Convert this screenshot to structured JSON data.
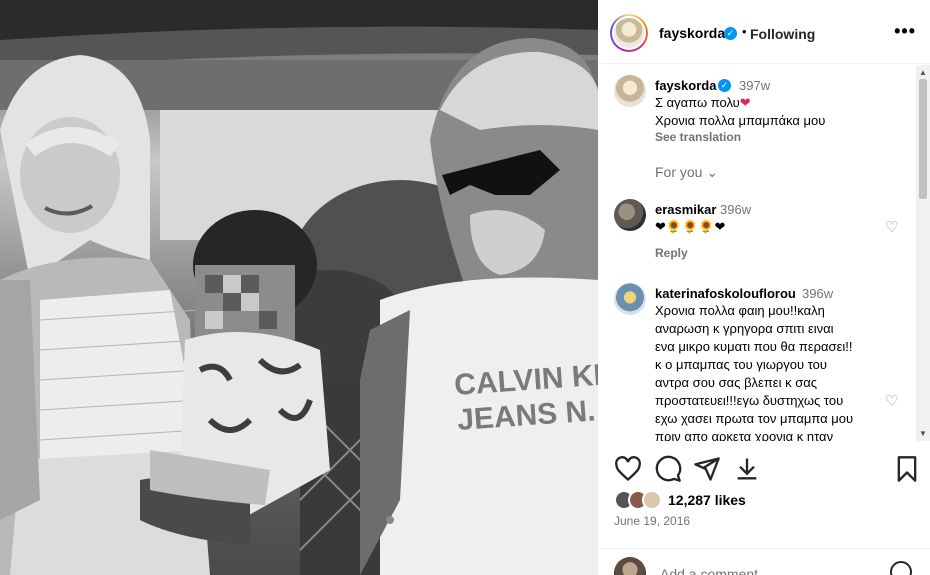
{
  "header": {
    "username": "fayskorda",
    "separator": "•",
    "follow_status": "Following",
    "more": "•••"
  },
  "caption": {
    "username": "fayskorda",
    "time": "397w",
    "line1": "Σ αγαπω πολυ",
    "line1_emoji": "❤",
    "line2": "Χρονια πολλα μπαμπάκα μου",
    "see_translation": "See translation"
  },
  "for_you": "For you",
  "comments": [
    {
      "username": "erasmikar",
      "time": "396w",
      "text": "❤🌻🌻🌻❤",
      "reply": "Reply"
    },
    {
      "username": "katerinafoskolouflorou",
      "time": "396w",
      "lines": [
        "Χρονια πολλα φαιη μου!!καλη",
        "αναρωση κ γρηγορα σπιτι ειναι",
        "ενα μικρο κυματι που θα περασει!!",
        "κ ο μπαμπας του γιωργου του",
        "αντρα σου σας βλεπει κ σας",
        "προστατευει!!!εγω δυστηχως του",
        "εχω χασει πρωτα τον μπαμπα μου",
        "πριν απο αρκετα χρονια κ ηταν"
      ]
    }
  ],
  "photo_text": {
    "shirt_line1": "CALVIN KLI",
    "shirt_line2": "JEANS N."
  },
  "likes": "12,287 likes",
  "date": "June 19, 2016",
  "add_comment_placeholder": "Add a comment...",
  "colors": {
    "verified": "#0095f6",
    "muted": "#737373",
    "heart_red": "#e0245e"
  }
}
